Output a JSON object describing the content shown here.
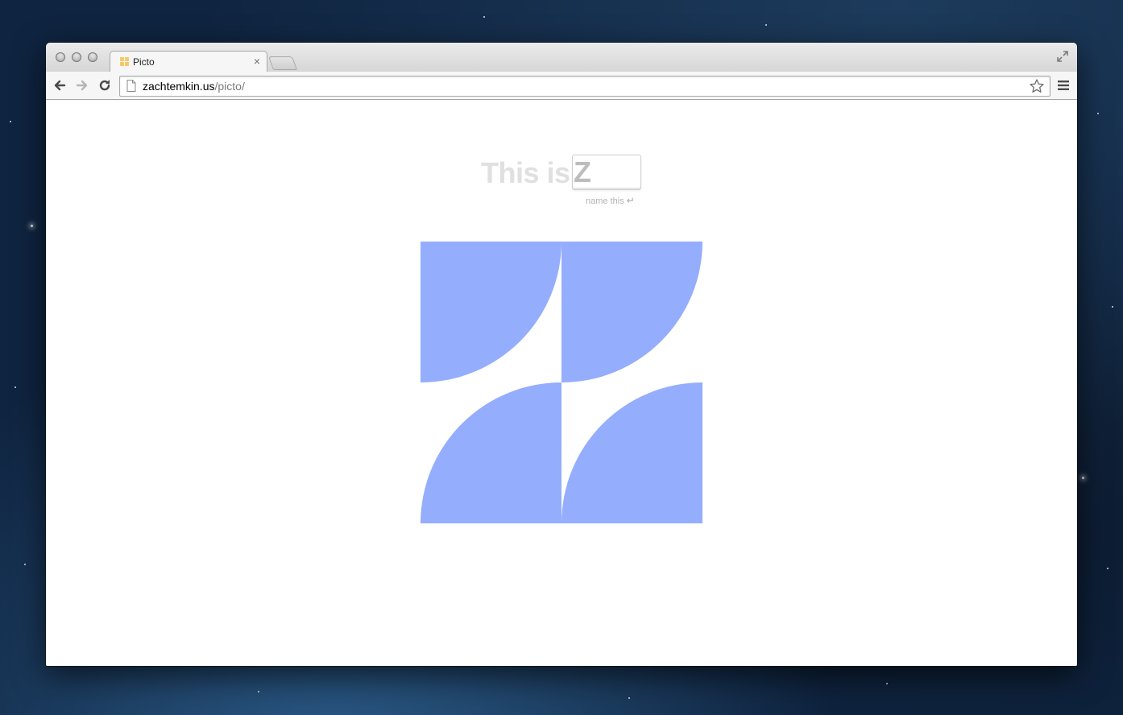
{
  "browser": {
    "tab_title": "Picto",
    "tab_close": "×",
    "url_domain": "zachtemkin.us",
    "url_path": "/picto/"
  },
  "page": {
    "heading": "This is",
    "input_value": "Z",
    "hint": "name this",
    "hint_icon": "return-arrow-icon",
    "picto_color": "#94adfd",
    "picto_letter": "Z"
  },
  "colors": {
    "heading": "#e0e0e0",
    "hint": "#b3b3b3",
    "shape": "#94adfd"
  }
}
